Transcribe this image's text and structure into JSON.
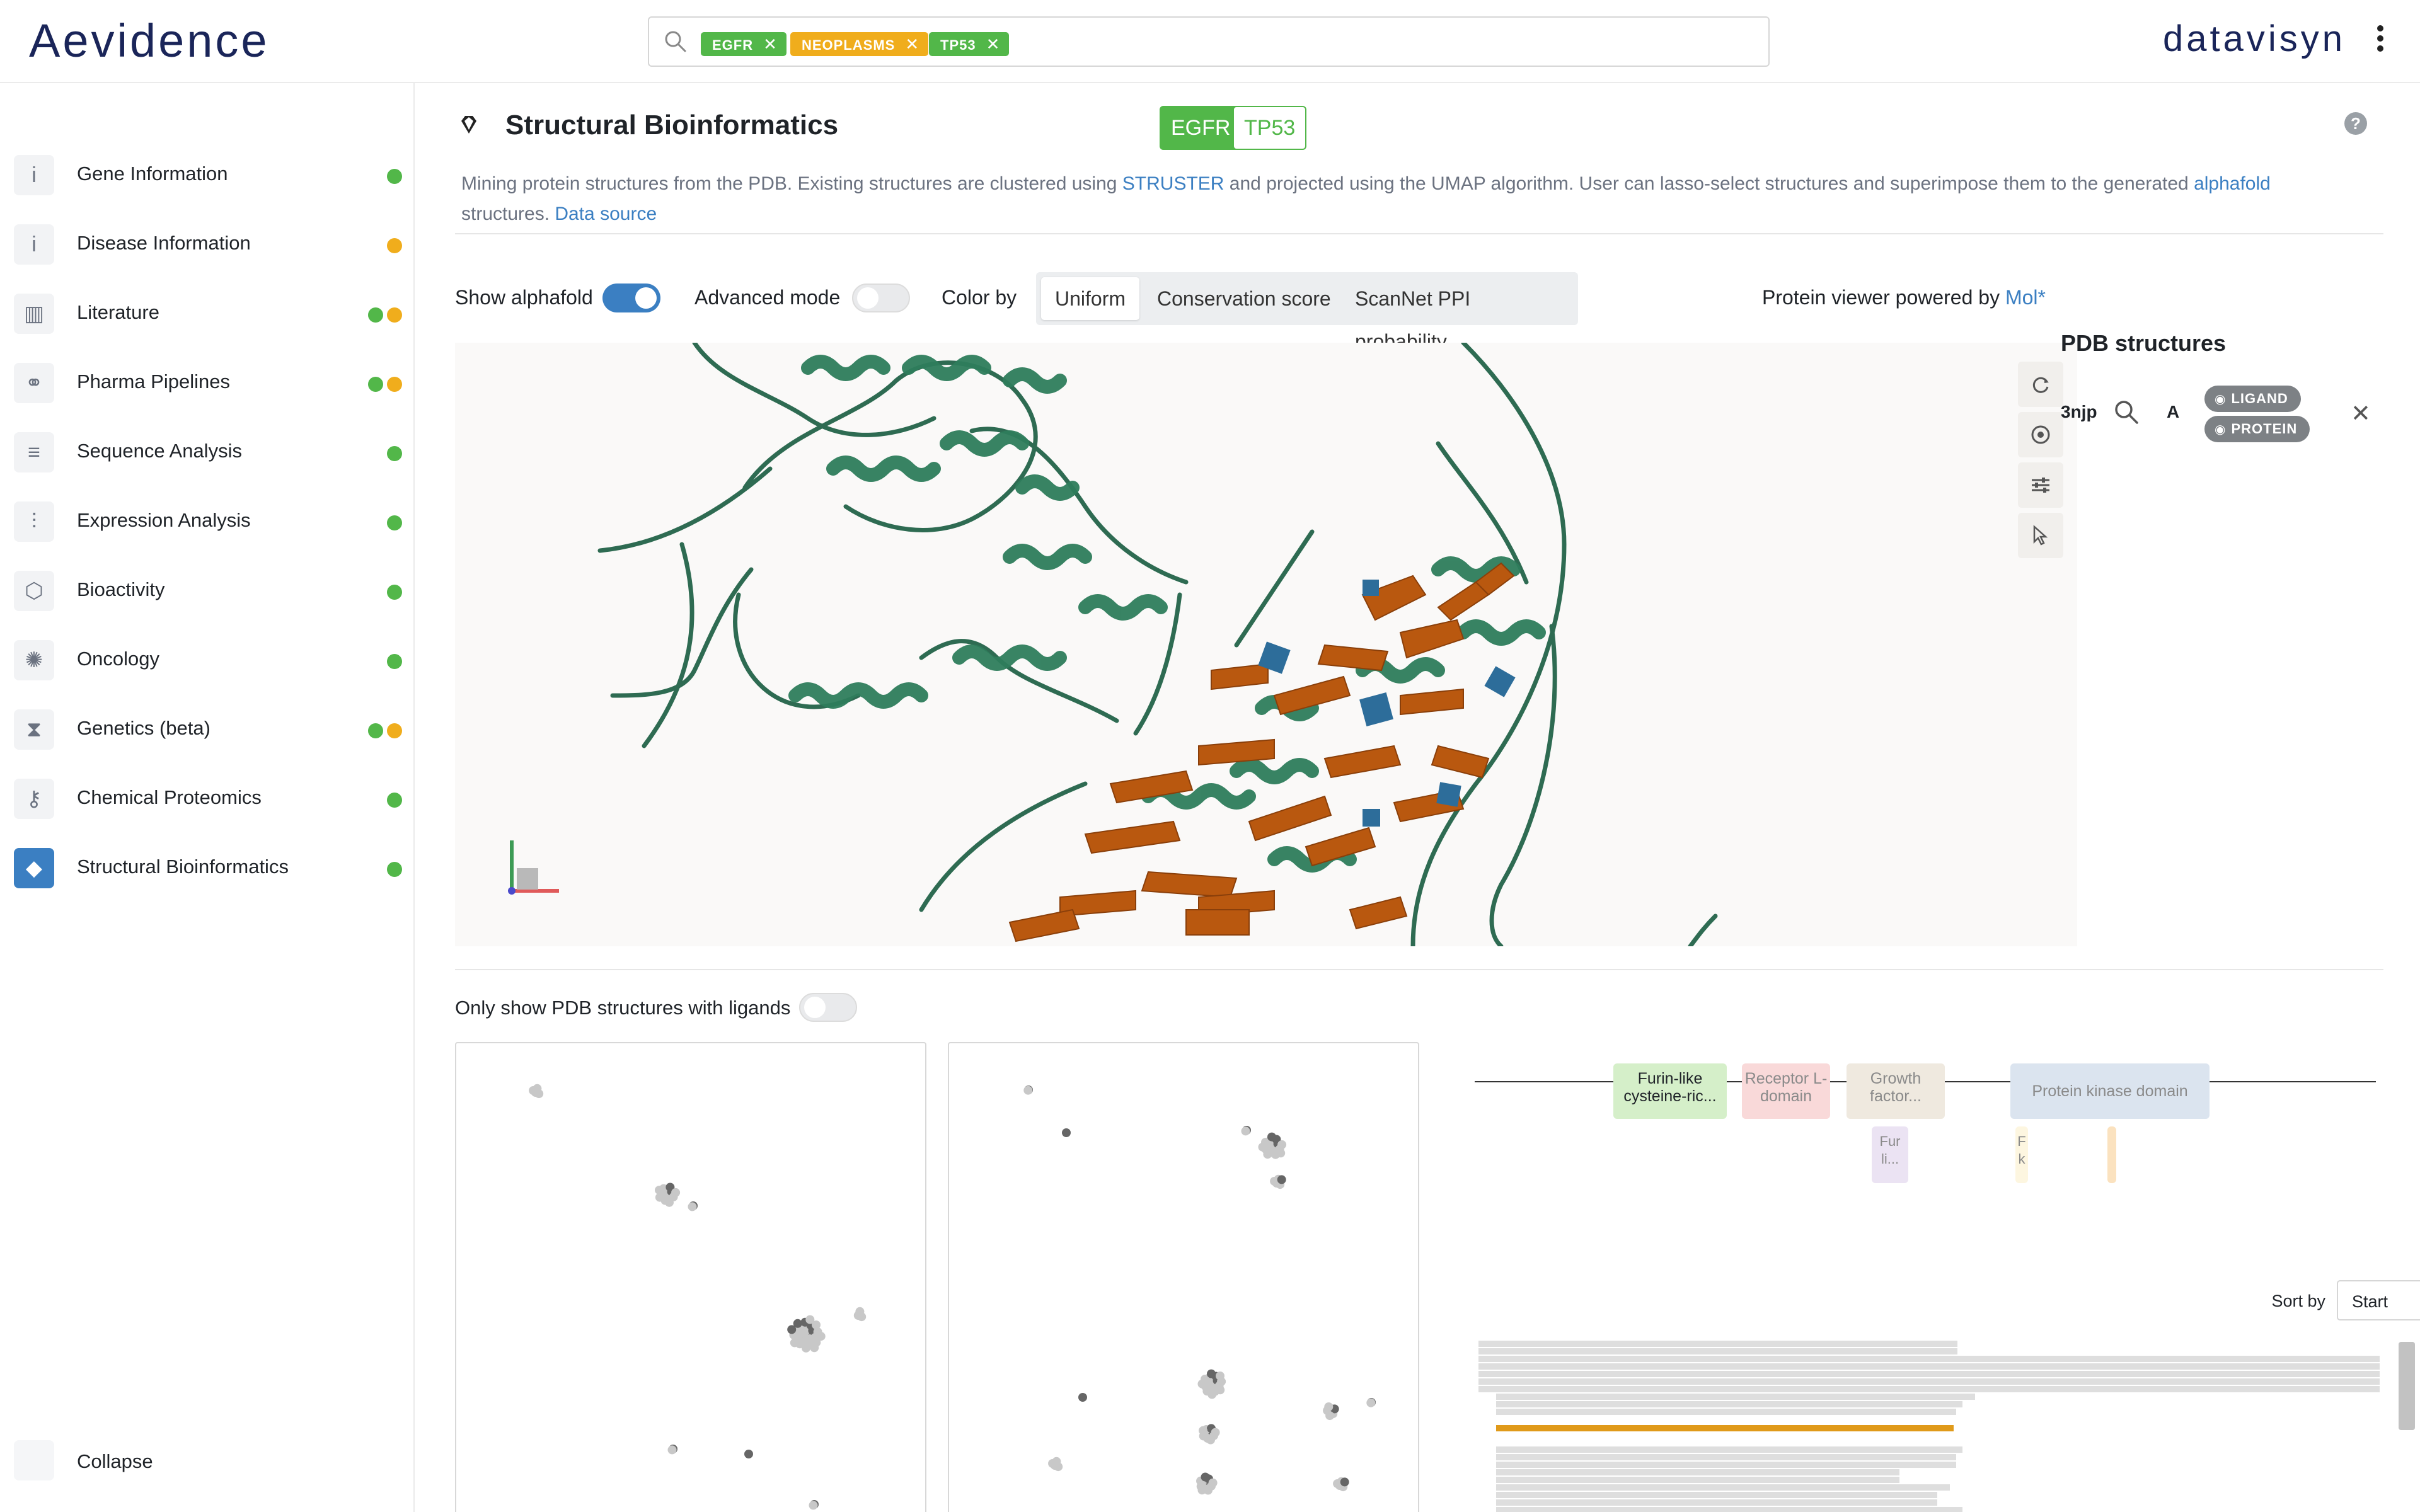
{
  "header": {
    "logo": "Aevidence",
    "brand": "datavisyn",
    "search_chips": [
      {
        "label": "EGFR",
        "color": "#52b749"
      },
      {
        "label": "NEOPLASMS",
        "color": "#f0ad1c"
      },
      {
        "label": "TP53",
        "color": "#52b749"
      }
    ]
  },
  "sidebar": {
    "items": [
      {
        "label": "Gene Information",
        "icon": "info-icon",
        "dots": [
          "green"
        ]
      },
      {
        "label": "Disease Information",
        "icon": "info-icon",
        "dots": [
          "orange"
        ]
      },
      {
        "label": "Literature",
        "icon": "book-icon",
        "dots": [
          "green",
          "orange"
        ]
      },
      {
        "label": "Pharma Pipelines",
        "icon": "pills-icon",
        "dots": [
          "green",
          "orange"
        ]
      },
      {
        "label": "Sequence Analysis",
        "icon": "align-icon",
        "dots": [
          "green"
        ]
      },
      {
        "label": "Expression Analysis",
        "icon": "sliders-icon",
        "dots": [
          "green"
        ]
      },
      {
        "label": "Bioactivity",
        "icon": "hexagon-icon",
        "dots": [
          "green"
        ]
      },
      {
        "label": "Oncology",
        "icon": "virus-icon",
        "dots": [
          "green"
        ]
      },
      {
        "label": "Genetics (beta)",
        "icon": "dna-icon",
        "dots": [
          "green",
          "orange"
        ]
      },
      {
        "label": "Chemical Proteomics",
        "icon": "key-icon",
        "dots": [
          "green"
        ]
      },
      {
        "label": "Structural Bioinformatics",
        "icon": "gem-icon",
        "dots": [
          "green"
        ],
        "active": true
      }
    ],
    "collapse_label": "Collapse"
  },
  "main": {
    "title": "Structural Bioinformatics",
    "gene_tags": [
      "EGFR",
      "TP53"
    ],
    "description": {
      "part1": "Mining protein structures from the PDB. Existing structures are clustered using ",
      "link1": "STRUSTER",
      "part2": " and projected using the UMAP algorithm. User can lasso-select structures and superimpose them to the generated ",
      "link2": "alphafold",
      "part3": " structures. ",
      "link3": "Data source"
    },
    "controls": {
      "show_alphafold": "Show alphafold",
      "advanced_mode": "Advanced mode",
      "color_by": "Color by",
      "color_options": [
        "Uniform",
        "Conservation score",
        "ScanNet PPI probability"
      ],
      "selected_color": "Uniform",
      "powered_text": "Protein viewer powered by ",
      "powered_link": "Mol*"
    },
    "pdb": {
      "title": "PDB structures",
      "id": "3njp",
      "chain": "A",
      "pills": [
        "LIGAND",
        "PROTEIN"
      ]
    },
    "ligands_toggle_label": "Only show PDB structures with ligands",
    "domains": [
      {
        "label": "Furin-like cysteine-ric...",
        "bg": "#d5efc9",
        "color": "#1f2328"
      },
      {
        "label": "Receptor L-domain",
        "bg": "#f9d9d9",
        "color": "#8a8a8a"
      },
      {
        "label": "Growth factor...",
        "bg": "#efe9df",
        "color": "#8a8a8a"
      },
      {
        "label": "Protein kinase domain",
        "bg": "#dbe4ef",
        "color": "#8a8a8a"
      },
      {
        "label": "Fur li...",
        "bg": "#ebe3f3",
        "color": "#8a8a8a"
      },
      {
        "label": "F k",
        "bg": "#fdf6e0",
        "color": "#8a8a8a"
      },
      {
        "label": "",
        "bg": "#fbe2bf",
        "color": "#8a8a8a"
      }
    ],
    "sort": {
      "label": "Sort by",
      "value": "Start"
    }
  }
}
